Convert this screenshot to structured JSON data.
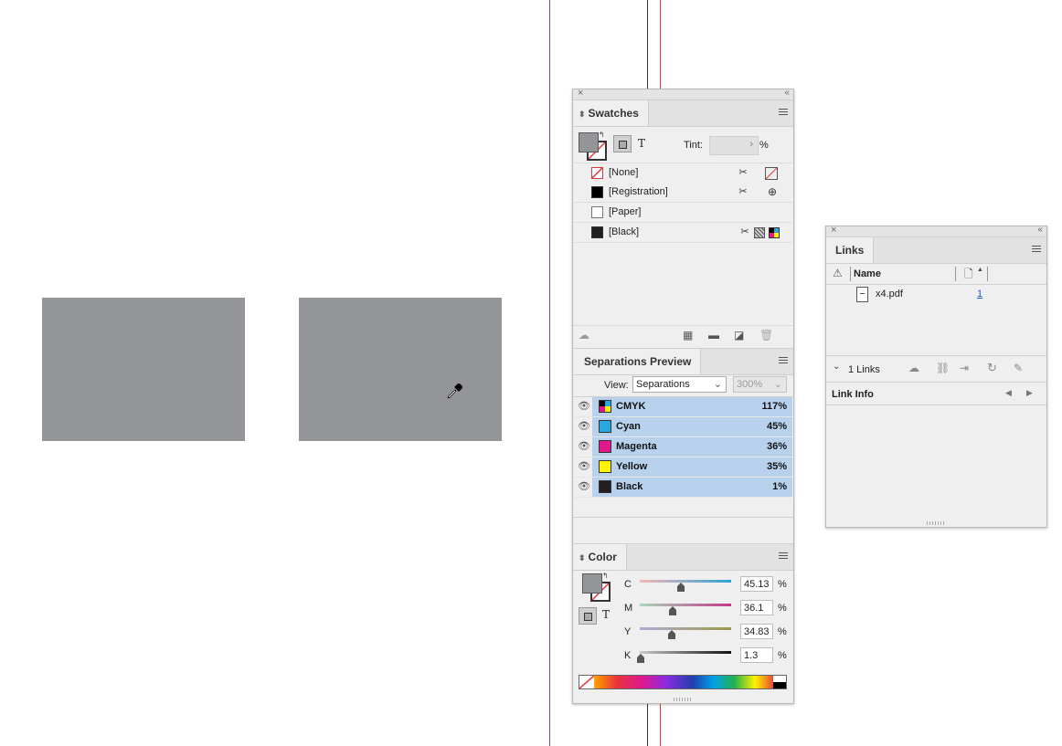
{
  "swatches": {
    "title": "Swatches",
    "tint_label": "Tint:",
    "tint_value": "",
    "tint_unit": "%",
    "items": [
      {
        "name": "[None]",
        "color": "none"
      },
      {
        "name": "[Registration]",
        "color": "#000000"
      },
      {
        "name": "[Paper]",
        "color": "#ffffff"
      },
      {
        "name": "[Black]",
        "color": "#231f20"
      }
    ]
  },
  "separations": {
    "title": "Separations Preview",
    "view_label": "View:",
    "view_value": "Separations",
    "zoom_value": "300%",
    "rows": [
      {
        "name": "CMYK",
        "value": "117%",
        "color": "cmyk"
      },
      {
        "name": "Cyan",
        "value": "45%",
        "color": "#29a8e0"
      },
      {
        "name": "Magenta",
        "value": "36%",
        "color": "#e0188c"
      },
      {
        "name": "Yellow",
        "value": "35%",
        "color": "#fff200"
      },
      {
        "name": "Black",
        "value": "1%",
        "color": "#231f20"
      }
    ]
  },
  "color": {
    "title": "Color",
    "channels": [
      {
        "label": "C",
        "value": "45.13",
        "level": 0.4513
      },
      {
        "label": "M",
        "value": "36.1",
        "level": 0.361
      },
      {
        "label": "Y",
        "value": "34.83",
        "level": 0.3483
      },
      {
        "label": "K",
        "value": "1.3",
        "level": 0.013
      }
    ],
    "unit": "%",
    "text_icon": "T"
  },
  "links": {
    "title": "Links",
    "column_name": "Name",
    "files": [
      {
        "name": "x4.pdf",
        "page": "1"
      }
    ],
    "count_label": "1 Links",
    "link_info_label": "Link Info"
  },
  "colors": {
    "canvas_rect": "#939598",
    "selection": "#b8d2ee",
    "guide_purple": "#7b3fa0",
    "guide_red": "#e8343a"
  }
}
